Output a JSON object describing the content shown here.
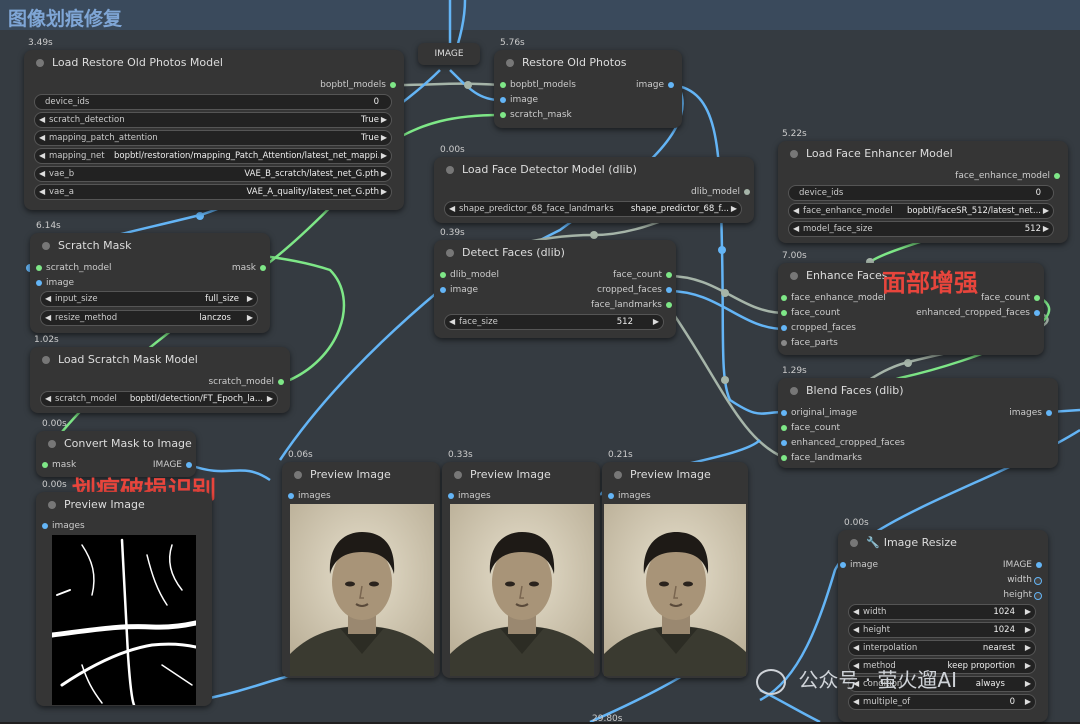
{
  "group": {
    "title": "图像划痕修复"
  },
  "annotations": {
    "face_enhance": "面部增强",
    "scratch_detect": "划痕破损识别"
  },
  "reroute": {
    "label": "IMAGE"
  },
  "bottom_time": "29.80s",
  "watermark": {
    "text": "公众号 · 萤火遛AI",
    "icon": "wechat-icon"
  },
  "nodes": {
    "load_restore": {
      "time": "3.49s",
      "title": "Load Restore Old Photos Model",
      "output": "bopbtl_models",
      "widgets": [
        {
          "label": "device_ids",
          "value": "0"
        },
        {
          "label": "scratch_detection",
          "value": "True"
        },
        {
          "label": "mapping_patch_attention",
          "value": "True"
        },
        {
          "label": "mapping_net",
          "value": "bopbtl/restoration/mapping_Patch_Attention/latest_net_mappi..."
        },
        {
          "label": "vae_b",
          "value": "VAE_B_scratch/latest_net_G.pth"
        },
        {
          "label": "vae_a",
          "value": "VAE_A_quality/latest_net_G.pth"
        }
      ]
    },
    "restore_photos": {
      "time": "5.76s",
      "title": "Restore Old Photos",
      "inputs": [
        "bopbtl_models",
        "image",
        "scratch_mask"
      ],
      "output": "image"
    },
    "face_detector": {
      "time": "0.00s",
      "title": "Load Face Detector Model (dlib)",
      "output": "dlib_model",
      "widgets": [
        {
          "label": "shape_predictor_68_face_landmarks",
          "value": "shape_predictor_68_f..."
        }
      ]
    },
    "face_enhancer": {
      "time": "5.22s",
      "title": "Load Face Enhancer Model",
      "output": "face_enhance_model",
      "widgets": [
        {
          "label": "device_ids",
          "value": "0"
        },
        {
          "label": "face_enhance_model",
          "value": "bopbtl/FaceSR_512/latest_net..."
        },
        {
          "label": "model_face_size",
          "value": "512"
        }
      ]
    },
    "scratch_mask": {
      "time": "6.14s",
      "title": "Scratch Mask",
      "inputs": [
        "scratch_model",
        "image"
      ],
      "output": "mask",
      "widgets": [
        {
          "label": "input_size",
          "value": "full_size"
        },
        {
          "label": "resize_method",
          "value": "lanczos"
        }
      ]
    },
    "detect_faces": {
      "time": "0.39s",
      "title": "Detect Faces (dlib)",
      "inputs": [
        "dlib_model",
        "image"
      ],
      "outputs": [
        "face_count",
        "cropped_faces",
        "face_landmarks"
      ],
      "widgets": [
        {
          "label": "face_size",
          "value": "512"
        }
      ]
    },
    "enhance_faces": {
      "time": "7.00s",
      "title": "Enhance Faces",
      "inputs": [
        "face_enhance_model",
        "face_count",
        "cropped_faces",
        "face_parts"
      ],
      "outputs": [
        "face_count",
        "enhanced_cropped_faces"
      ]
    },
    "load_scratch_model": {
      "time": "1.02s",
      "title": "Load Scratch Mask Model",
      "output": "scratch_model",
      "widgets": [
        {
          "label": "scratch_model",
          "value": "bopbtl/detection/FT_Epoch_la..."
        }
      ]
    },
    "blend_faces": {
      "time": "1.29s",
      "title": "Blend Faces (dlib)",
      "inputs": [
        "original_image",
        "face_count",
        "enhanced_cropped_faces",
        "face_landmarks"
      ],
      "output": "images"
    },
    "convert_mask": {
      "time": "0.00s",
      "title": "Convert Mask to Image",
      "input": "mask",
      "output": "IMAGE"
    },
    "preview_mask": {
      "time": "0.00s",
      "title": "Preview Image",
      "input": "images"
    },
    "preview1": {
      "time": "0.06s",
      "title": "Preview Image",
      "input": "images"
    },
    "preview2": {
      "time": "0.33s",
      "title": "Preview Image",
      "input": "images"
    },
    "preview3": {
      "time": "0.21s",
      "title": "Preview Image",
      "input": "images"
    },
    "image_resize": {
      "time": "0.00s",
      "title": "Image Resize",
      "input": "image",
      "outputs": [
        "IMAGE",
        "width",
        "height"
      ],
      "widgets": [
        {
          "label": "width",
          "value": "1024"
        },
        {
          "label": "height",
          "value": "1024"
        },
        {
          "label": "interpolation",
          "value": "nearest"
        },
        {
          "label": "method",
          "value": "keep proportion"
        },
        {
          "label": "condition",
          "value": "always"
        },
        {
          "label": "multiple_of",
          "value": "0"
        }
      ]
    }
  },
  "colors": {
    "canvas": "#353b41",
    "node": "#353535",
    "link_image": "#64b5f6",
    "link_model": "#7ee787",
    "link_other": "#a6b5a9",
    "annotation": "#e8453c"
  }
}
